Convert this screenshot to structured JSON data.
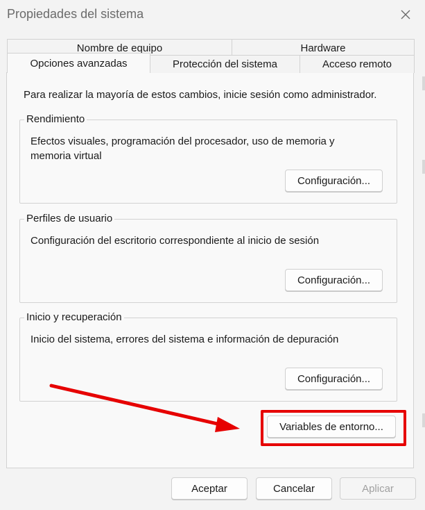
{
  "window": {
    "title": "Propiedades del sistema",
    "close_icon": "close-icon"
  },
  "tabs": {
    "row1": [
      {
        "label": "Nombre de equipo"
      },
      {
        "label": "Hardware"
      }
    ],
    "row2": [
      {
        "label": "Opciones avanzadas",
        "active": true
      },
      {
        "label": "Protección del sistema"
      },
      {
        "label": "Acceso remoto"
      }
    ]
  },
  "panel": {
    "notice": "Para realizar la mayoría de estos cambios, inicie sesión como administrador.",
    "groups": [
      {
        "title": "Rendimiento",
        "description": "Efectos visuales, programación del procesador, uso de memoria y memoria virtual",
        "button_label": "Configuración..."
      },
      {
        "title": "Perfiles de usuario",
        "description": "Configuración del escritorio correspondiente al inicio de sesión",
        "button_label": "Configuración..."
      },
      {
        "title": "Inicio y recuperación",
        "description": "Inicio del sistema, errores del sistema e información de depuración",
        "button_label": "Configuración..."
      }
    ],
    "env_button_label": "Variables de entorno..."
  },
  "footer": {
    "ok_label": "Aceptar",
    "cancel_label": "Cancelar",
    "apply_label": "Aplicar"
  },
  "annotation": {
    "color": "#e60000"
  }
}
